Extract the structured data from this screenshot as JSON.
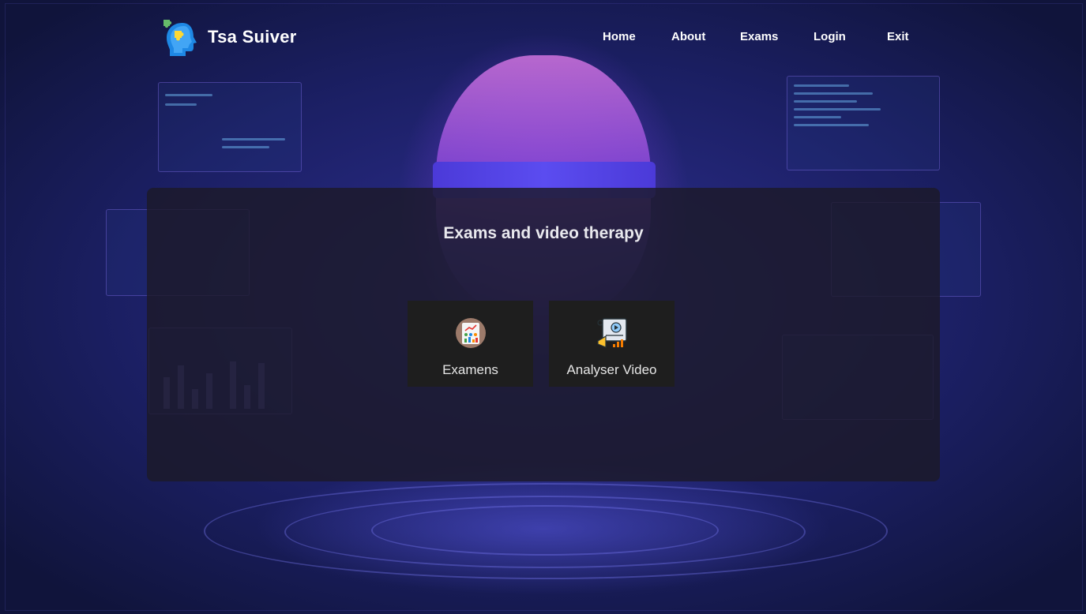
{
  "brand": {
    "name": "Tsa Suiver",
    "logo_icon": "puzzle-head-icon"
  },
  "nav": {
    "items": [
      {
        "label": "Home"
      },
      {
        "label": "About"
      },
      {
        "label": "Exams"
      },
      {
        "label": "Login"
      },
      {
        "label": "Exit"
      }
    ]
  },
  "main": {
    "title": "Exams and video therapy",
    "tiles": [
      {
        "label": "Examens",
        "icon": "report-chart-icon"
      },
      {
        "label": "Analyser Video",
        "icon": "video-analysis-icon"
      }
    ]
  },
  "colors": {
    "card_bg": "#1c1a28",
    "tile_bg": "#1e1e1e",
    "text": "#ffffff",
    "accent": "#4b3ad8"
  }
}
